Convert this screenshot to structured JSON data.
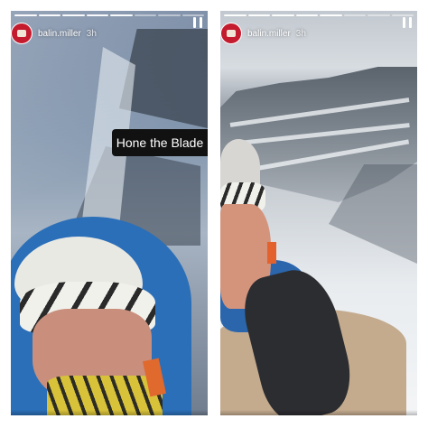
{
  "stories": [
    {
      "username": "balin.miller",
      "time_ago": "3h",
      "caption": "Hone the Blade",
      "progress_segments": 8,
      "progress_filled": 5
    },
    {
      "username": "balin.miller",
      "time_ago": "3h",
      "progress_segments": 8,
      "progress_filled": 5
    }
  ],
  "colors": {
    "avatar": "#c41b2e",
    "caption_bg": "#111111"
  },
  "icons": {
    "pause": "pause-icon",
    "avatar": "profile-avatar-icon"
  }
}
